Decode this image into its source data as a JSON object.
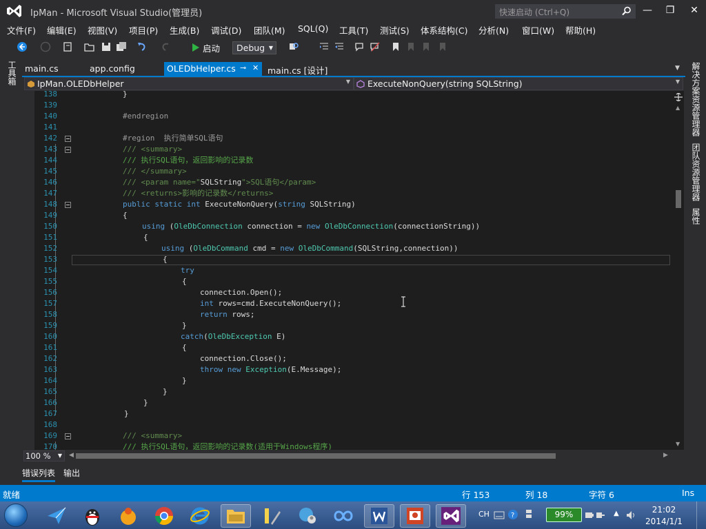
{
  "window": {
    "title": "IpMan - Microsoft Visual Studio(管理员)",
    "quick_launch_placeholder": "快速启动 (Ctrl+Q)",
    "minimize": "—",
    "restore": "❐",
    "close": "✕"
  },
  "menu": [
    "文件(F)",
    "编辑(E)",
    "视图(V)",
    "项目(P)",
    "生成(B)",
    "调试(D)",
    "团队(M)",
    "SQL(Q)",
    "工具(T)",
    "测试(S)",
    "体系结构(C)",
    "分析(N)",
    "窗口(W)",
    "帮助(H)"
  ],
  "toolbar": {
    "start_label": "启动",
    "config_label": "Debug"
  },
  "left_panel": {
    "toolbox": "工具箱"
  },
  "right_panel": {
    "solution_explorer": "解决方案资源管理器",
    "team_explorer": "团队资源管理器",
    "properties": "属性"
  },
  "tabs": {
    "items": [
      {
        "label": "main.cs"
      },
      {
        "label": "app.config"
      },
      {
        "label": "OLEDbHelper.cs"
      },
      {
        "label": "main.cs [设计]"
      }
    ],
    "pin": "⊸",
    "close": "✕"
  },
  "navbar": {
    "class_name": "IpMan.OLEDbHelper",
    "member_name": "ExecuteNonQuery(string SQLString)"
  },
  "code": {
    "line_numbers": [
      "138",
      "139",
      "140",
      "141",
      "142",
      "143",
      "144",
      "145",
      "146",
      "147",
      "148",
      "149",
      "150",
      "151",
      "152",
      "153",
      "154",
      "155",
      "156",
      "157",
      "158",
      "159",
      "160",
      "161",
      "162",
      "163",
      "164",
      "165",
      "166",
      "167",
      "168",
      "169",
      "170"
    ],
    "l138": "}",
    "l140": "#endregion",
    "l142": "#region  执行简单SQL语句",
    "l143": "/// <summary>",
    "l144": "/// 执行SQL语句，返回影响的记录数",
    "l145": "/// </summary>",
    "l146a": "/// <param name=\"",
    "l146b": "SQLString",
    "l146c": "\">SQL语句</param>",
    "l147": "/// <returns>影响的记录数</returns>",
    "l148_kw": "public static int",
    "l148_name": " ExecuteNonQuery(",
    "l148_kw2": "string",
    "l148_end": " SQLString)",
    "l149": "{",
    "l150_kw": "using",
    "l150_type": "OleDbConnection",
    "l150_mid": " connection = ",
    "l150_new": "new",
    "l150_type2": "OleDbConnection",
    "l150_end": "(connectionString))",
    "l151": "{",
    "l152_kw": "using",
    "l152_type": "OleDbCommand",
    "l152_mid": " cmd = ",
    "l152_new": "new",
    "l152_type2": "OleDbCommand",
    "l152_end": "(SQLString,connection))",
    "l153": "{",
    "l154": "try",
    "l155": "{",
    "l156": "connection.Open();",
    "l157_kw": "int",
    "l157_rest": " rows=cmd.ExecuteNonQuery();",
    "l158_kw": "return",
    "l158_rest": " rows;",
    "l159": "}",
    "l160_kw": "catch",
    "l160_type": "OleDbException",
    "l160_end": " E)",
    "l161": "{",
    "l162": "connection.Close();",
    "l163_kw": "throw new",
    "l163_type": "Exception",
    "l163_end": "(E.Message);",
    "l164": "}",
    "l165": "}",
    "l166": "}",
    "l167": "}",
    "l169": "/// <summary>",
    "l170": "/// 执行SQL语句，返回影响的记录数(适用于Windows程序)"
  },
  "editor": {
    "zoom": "100 %"
  },
  "bottom_tabs": [
    "错误列表",
    "输出"
  ],
  "status": {
    "ready": "就绪",
    "line": "行 153",
    "col": "列 18",
    "char": "字符 6",
    "mode": "Ins"
  },
  "taskbar": {
    "lang": "CH",
    "battery": "99%",
    "time": "21:02",
    "date": "2014/1/1"
  },
  "colors": {
    "accent": "#007acc",
    "editor_bg": "#1e1e1e",
    "keyword": "#569cd6",
    "type": "#4ec9b0",
    "comment": "#57a64a"
  }
}
